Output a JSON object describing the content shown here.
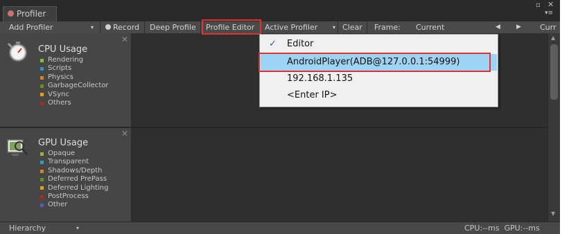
{
  "window": {
    "tab_title": "Profiler",
    "controls": {
      "maximize": "▫",
      "close": "✕",
      "menu": "▾≡"
    }
  },
  "toolbar": {
    "add_profiler": "Add Profiler",
    "record": "Record",
    "deep_profile": "Deep Profile",
    "profile_editor": "Profile Editor",
    "active_profiler": "Active Profiler",
    "clear": "Clear",
    "frame_label": "Frame:",
    "frame_value": "Current",
    "current_cut": "Curr"
  },
  "panels": [
    {
      "title": "CPU Usage",
      "legend": [
        {
          "label": "Rendering",
          "color": "#8cb83c"
        },
        {
          "label": "Scripts",
          "color": "#3a8fc4"
        },
        {
          "label": "Physics",
          "color": "#d2822a"
        },
        {
          "label": "GarbageCollector",
          "color": "#70882e"
        },
        {
          "label": "VSync",
          "color": "#d9a41c"
        },
        {
          "label": "Others",
          "color": "#a4301e"
        }
      ]
    },
    {
      "title": "GPU Usage",
      "legend": [
        {
          "label": "Opaque",
          "color": "#8cb83c"
        },
        {
          "label": "Transparent",
          "color": "#3a9ab0"
        },
        {
          "label": "Shadows/Depth",
          "color": "#d2822a"
        },
        {
          "label": "Deferred PrePass",
          "color": "#70882e"
        },
        {
          "label": "Deferred Lighting",
          "color": "#d9a41c"
        },
        {
          "label": "PostProcess",
          "color": "#a4301e"
        },
        {
          "label": "Other",
          "color": "#5a5ab0"
        }
      ]
    }
  ],
  "dropdown": {
    "items": [
      {
        "label": "Editor",
        "checked": true
      },
      {
        "label": "AndroidPlayer(ADB@127.0.0.1:54999)",
        "checked": false
      },
      {
        "label": "192.168.1.135",
        "checked": false
      },
      {
        "label": "<Enter IP>",
        "checked": false
      }
    ],
    "check_glyph": "✓"
  },
  "bottom": {
    "view": "Hierarchy",
    "stats": "CPU:--ms  GPU:--ms"
  }
}
